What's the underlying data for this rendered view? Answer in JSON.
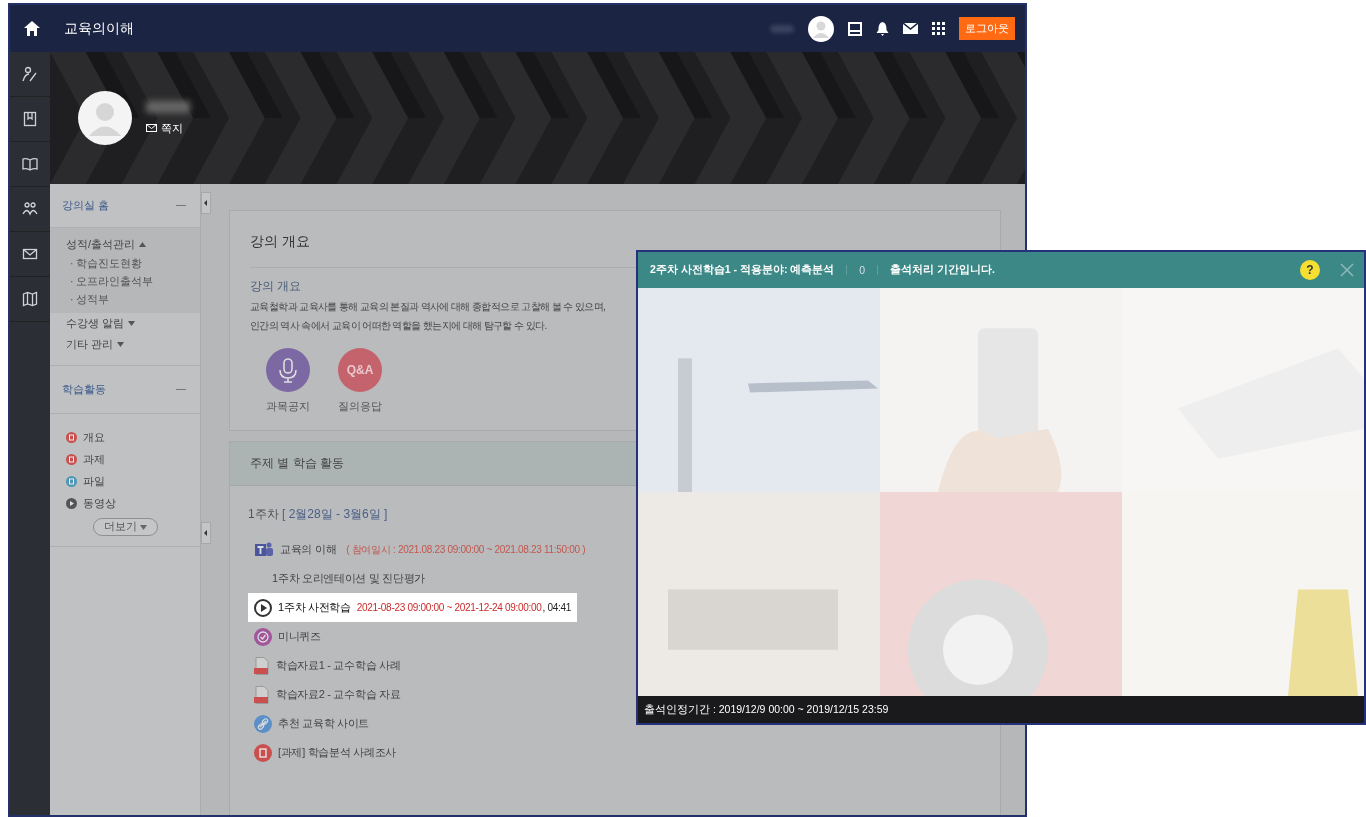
{
  "top_bar": {
    "title": "교육의이해",
    "logout_button": "로그아웃"
  },
  "profile": {
    "message_link": "쪽지"
  },
  "sidebar": {
    "sections": [
      {
        "title": "강의실 홈",
        "items": [
          {
            "label": "성적/출석관리",
            "expanded": true,
            "children": [
              {
                "label": "· 학습진도현황"
              },
              {
                "label": "· 오프라인출석부"
              },
              {
                "label": "· 성적부"
              }
            ]
          },
          {
            "label": "수강생 알림",
            "expanded": false
          },
          {
            "label": "기타 관리",
            "expanded": false
          }
        ]
      },
      {
        "title": "학습활동",
        "activities": [
          {
            "kind": "overview",
            "label": "개요"
          },
          {
            "kind": "assignment",
            "label": "과제"
          },
          {
            "kind": "file",
            "label": "파일"
          },
          {
            "kind": "video",
            "label": "동영상"
          }
        ],
        "more_button": "더보기"
      }
    ]
  },
  "course_overview": {
    "title": "강의 개요",
    "subtitle": "강의 개요",
    "description": [
      "교육철학과 교육사를 통해 교육의 본질과 역사에 대해 종합적으로 고찰해 볼 수 있으며,",
      "인간의 역사 속에서 교육이 어떠한 역할을 했는지에 대해 탐구할 수 있다."
    ],
    "shortcuts": [
      {
        "kind": "notice",
        "label": "과목공지"
      },
      {
        "kind": "qna",
        "icon_text": "Q&A",
        "label": "질의응답"
      }
    ]
  },
  "weekly_activities": {
    "title": "주제 별 학습 활동",
    "weeks": [
      {
        "label": "1주차",
        "dates": "[ 2월28일 - 3월6일 ]",
        "items": [
          {
            "kind": "teams",
            "title": "교육의 이해",
            "period": "( 참여일시 : 2021.08.23 09:00:00 ~ 2021.08.23 11:50:00 )",
            "selected": false
          },
          {
            "kind": "text",
            "title": "1주차 오리엔테이션 및 진단평가",
            "selected": false
          },
          {
            "kind": "video",
            "title": "1주차 사전학습",
            "period": "2021-08-23 09:00:00 ~ 2021-12-24 09:00:00",
            "duration": ", 04:41",
            "selected": true
          },
          {
            "kind": "quiz",
            "title": "미니퀴즈",
            "selected": false
          },
          {
            "kind": "pdf",
            "title": "학습자료1 - 교수학습 사례",
            "selected": false
          },
          {
            "kind": "pdf",
            "title": "학습자료2 - 교수학습 자료",
            "selected": false
          },
          {
            "kind": "link",
            "title": "추천 교육학 사이트",
            "selected": false
          },
          {
            "kind": "assignment",
            "title": "[과제] 학습분석 사례조사",
            "selected": false
          }
        ]
      }
    ]
  },
  "video_popup": {
    "title": "2주차 사전학습1 - 적용분야: 예측분석",
    "count": "0",
    "status": "출석처리 기간입니다.",
    "help_button": "?",
    "footer": "출석인정기간 : 2019/12/9 00:00 ~ 2019/12/15 23:59"
  }
}
